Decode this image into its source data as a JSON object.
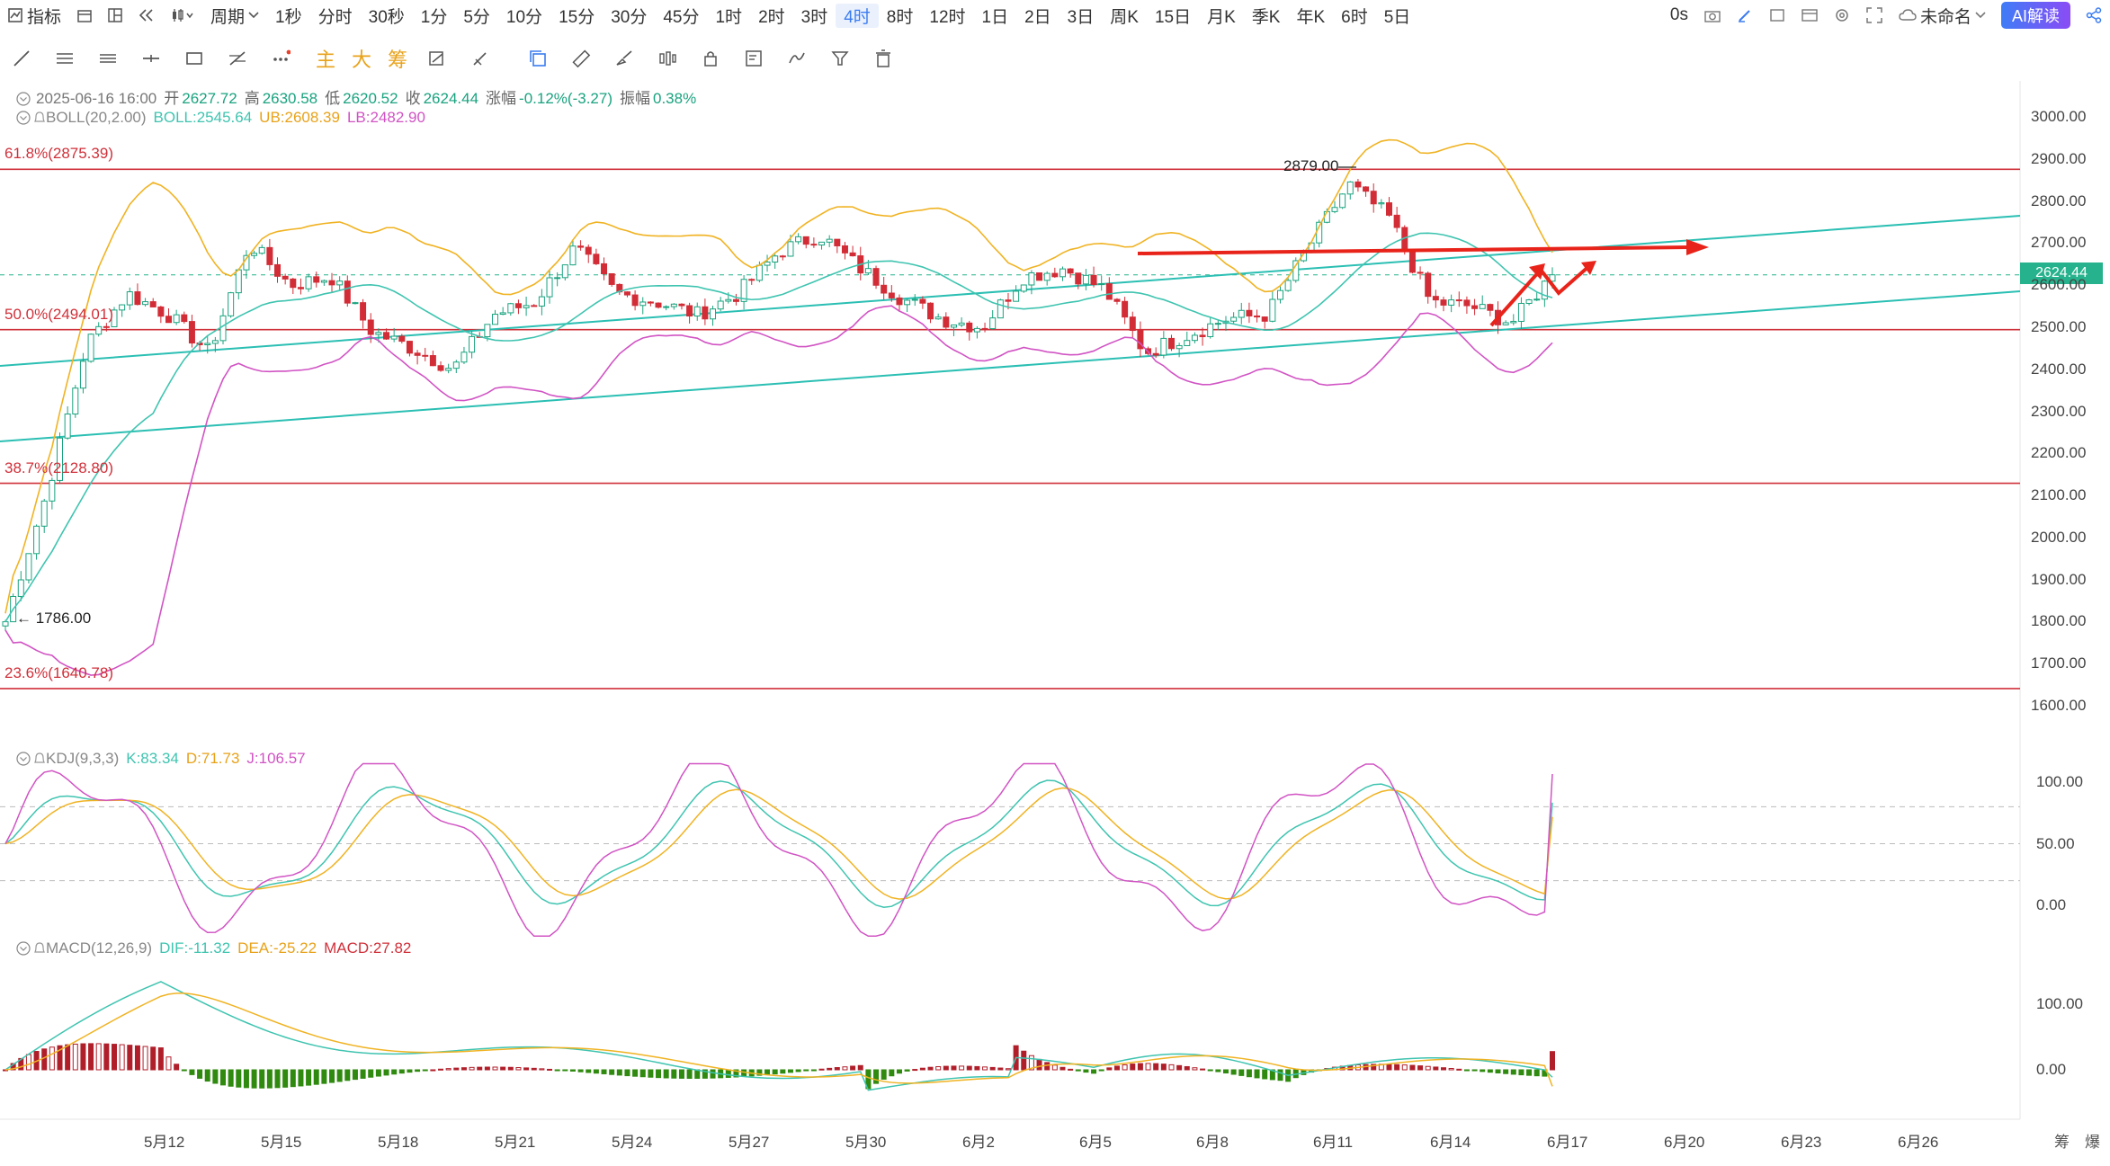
{
  "toolbar": {
    "indicators_label": "指标",
    "period_label": "周期",
    "timeframes": [
      "1秒",
      "分时",
      "30秒",
      "1分",
      "5分",
      "10分",
      "15分",
      "30分",
      "45分",
      "1时",
      "2时",
      "3时",
      "4时",
      "8时",
      "12时",
      "1日",
      "2日",
      "3日",
      "周K",
      "15日",
      "月K",
      "季K",
      "年K",
      "6时",
      "5日"
    ],
    "active_timeframe": "4时",
    "timer": "0s",
    "layout_name": "未命名",
    "ai_button": "AI解读"
  },
  "drawing_toolbar": {
    "tags": [
      "主",
      "大",
      "筹"
    ]
  },
  "ohlc": {
    "datetime": "2025-06-16 16:00",
    "open_label": "开",
    "open": "2627.72",
    "high_label": "高",
    "high": "2630.58",
    "low_label": "低",
    "low": "2620.52",
    "close_label": "收",
    "close": "2624.44",
    "change_label": "涨幅",
    "change": "-0.12%(-3.27)",
    "amplitude_label": "振幅",
    "amplitude": "0.38%"
  },
  "boll": {
    "name": "BOLL(20,2.00)",
    "mid": "BOLL:2545.64",
    "ub": "UB:2608.39",
    "lb": "LB:2482.90"
  },
  "kdj": {
    "name": "KDJ(9,3,3)",
    "k": "K:83.34",
    "d": "D:71.73",
    "j": "J:106.57"
  },
  "macd": {
    "name": "MACD(12,26,9)",
    "dif": "DIF:-11.32",
    "dea": "DEA:-25.22",
    "macd": "MACD:27.82"
  },
  "fib_levels": [
    {
      "label": "61.8%(2875.39)",
      "price": 2875.39
    },
    {
      "label": "50.0%(2494.01)",
      "price": 2494.01
    },
    {
      "label": "38.7%(2128.80)",
      "price": 2128.8
    },
    {
      "label": "23.6%(1640.78)",
      "price": 1640.78
    }
  ],
  "annotations": {
    "high_marker": "2879.00",
    "low_marker": "1786.00"
  },
  "current_price": "2624.44",
  "price_axis": [
    "3000.00",
    "2900.00",
    "2800.00",
    "2700.00",
    "2600.00",
    "2500.00",
    "2400.00",
    "2300.00",
    "2200.00",
    "2100.00",
    "2000.00",
    "1900.00",
    "1800.00",
    "1700.00",
    "1600.00"
  ],
  "kdj_axis": [
    "100.00",
    "50.00",
    "0.00"
  ],
  "macd_axis": [
    "100.00",
    "0.00"
  ],
  "date_axis": [
    "5月12",
    "5月15",
    "5月18",
    "5月21",
    "5月24",
    "5月27",
    "5月30",
    "6月2",
    "6月5",
    "6月8",
    "6月11",
    "6月14",
    "6月17",
    "6月20",
    "6月23",
    "6月26"
  ],
  "side_tabs": [
    "筹",
    "爆"
  ],
  "colors": {
    "up": "#d22c36",
    "down": "#1aa37f",
    "ub": "#f0b323",
    "lb": "#d154c4",
    "mid": "#3fc4b0",
    "fib": "#d0303a",
    "trend": "#2bbfb3",
    "arrow": "#e8231a"
  },
  "chart_data": {
    "type": "candlestick",
    "timeframe": "4h",
    "x_range": [
      "5月10",
      "6月16"
    ],
    "ylim": [
      1550,
      3050
    ],
    "close_path": [
      {
        "date": "5月10",
        "price": 1800
      },
      {
        "date": "5月11",
        "price": 2100
      },
      {
        "date": "5月11",
        "price": 2460
      },
      {
        "date": "5月12",
        "price": 2580
      },
      {
        "date": "5月13",
        "price": 2530
      },
      {
        "date": "5月14",
        "price": 2440
      },
      {
        "date": "5月15",
        "price": 2700
      },
      {
        "date": "5月16",
        "price": 2600
      },
      {
        "date": "5月17",
        "price": 2620
      },
      {
        "date": "5月18",
        "price": 2490
      },
      {
        "date": "5月19",
        "price": 2450
      },
      {
        "date": "5月20",
        "price": 2400
      },
      {
        "date": "5月21",
        "price": 2530
      },
      {
        "date": "5月22",
        "price": 2560
      },
      {
        "date": "5月23",
        "price": 2690
      },
      {
        "date": "5月24",
        "price": 2580
      },
      {
        "date": "5月25",
        "price": 2560
      },
      {
        "date": "5月26",
        "price": 2530
      },
      {
        "date": "5月27",
        "price": 2580
      },
      {
        "date": "5月28",
        "price": 2680
      },
      {
        "date": "5月29",
        "price": 2720
      },
      {
        "date": "5月30",
        "price": 2640
      },
      {
        "date": "5月31",
        "price": 2570
      },
      {
        "date": "6月1",
        "price": 2520
      },
      {
        "date": "6月2",
        "price": 2500
      },
      {
        "date": "6月3",
        "price": 2620
      },
      {
        "date": "6月4",
        "price": 2640
      },
      {
        "date": "6月5",
        "price": 2590
      },
      {
        "date": "6月6",
        "price": 2440
      },
      {
        "date": "6月7",
        "price": 2480
      },
      {
        "date": "6月8",
        "price": 2520
      },
      {
        "date": "6月9",
        "price": 2530
      },
      {
        "date": "6月10",
        "price": 2690
      },
      {
        "date": "6月11",
        "price": 2840
      },
      {
        "date": "6月12",
        "price": 2760
      },
      {
        "date": "6月13",
        "price": 2560
      },
      {
        "date": "6月14",
        "price": 2550
      },
      {
        "date": "6月15",
        "price": 2510
      },
      {
        "date": "6月16",
        "price": 2624
      }
    ],
    "series": [
      {
        "name": "BOLL",
        "last": 2545.64
      },
      {
        "name": "UB",
        "last": 2608.39
      },
      {
        "name": "LB",
        "last": 2482.9
      }
    ],
    "kdj": {
      "K": 83.34,
      "D": 71.73,
      "J": 106.57,
      "ylim": [
        0,
        100
      ]
    },
    "macd": {
      "DIF": -11.32,
      "DEA": -25.22,
      "MACD": 27.82
    }
  }
}
